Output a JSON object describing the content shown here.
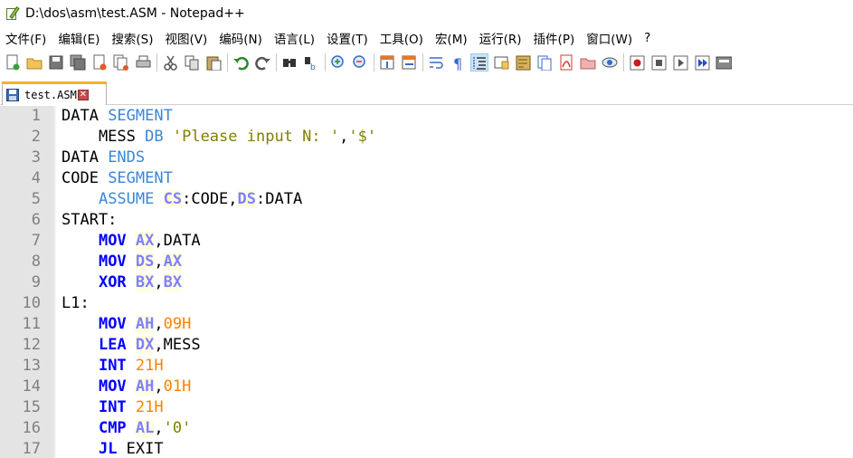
{
  "window": {
    "title": "D:\\dos\\asm\\test.ASM - Notepad++"
  },
  "menu": [
    "文件(F)",
    "编辑(E)",
    "搜索(S)",
    "视图(V)",
    "编码(N)",
    "语言(L)",
    "设置(T)",
    "工具(O)",
    "宏(M)",
    "运行(R)",
    "插件(P)",
    "窗口(W)",
    "?"
  ],
  "toolbar": [
    {
      "name": "new-file-icon"
    },
    {
      "name": "open-file-icon"
    },
    {
      "name": "save-icon"
    },
    {
      "name": "save-all-icon"
    },
    {
      "name": "close-icon"
    },
    {
      "name": "close-all-icon"
    },
    {
      "name": "print-icon"
    },
    {
      "sep": true
    },
    {
      "name": "cut-icon"
    },
    {
      "name": "copy-icon"
    },
    {
      "name": "paste-icon"
    },
    {
      "sep": true
    },
    {
      "name": "undo-icon"
    },
    {
      "name": "redo-icon"
    },
    {
      "sep": true
    },
    {
      "name": "find-icon"
    },
    {
      "name": "replace-icon"
    },
    {
      "sep": true
    },
    {
      "name": "zoom-in-icon"
    },
    {
      "name": "zoom-out-icon"
    },
    {
      "sep": true
    },
    {
      "name": "sync-vertical-icon"
    },
    {
      "name": "sync-horizontal-icon"
    },
    {
      "sep": true
    },
    {
      "name": "word-wrap-icon"
    },
    {
      "name": "show-all-chars-icon"
    },
    {
      "name": "indent-guide-icon",
      "active": true
    },
    {
      "name": "udl-icon"
    },
    {
      "name": "document-map-icon"
    },
    {
      "name": "function-list-icon"
    },
    {
      "name": "pdf-icon"
    },
    {
      "name": "folder-workspace-icon"
    },
    {
      "name": "monitor-icon"
    },
    {
      "sep": true
    },
    {
      "name": "record-macro-icon"
    },
    {
      "name": "stop-macro-icon"
    },
    {
      "name": "play-macro-icon"
    },
    {
      "name": "run-macro-multiple-icon"
    },
    {
      "name": "save-macro-icon"
    }
  ],
  "tab": {
    "label": "test.ASM"
  },
  "colors": {
    "directive": "#3a86d8",
    "instruction": "#0000ff",
    "register": "#8080ff",
    "string": "#808000",
    "number": "#ff8000",
    "gutter": "#e4e4e4",
    "tab_accent": "#fab028"
  },
  "lines": [
    {
      "no": "1",
      "tokens": [
        {
          "t": "DATA ",
          "c": "id"
        },
        {
          "t": "SEGMENT",
          "c": "dir"
        }
      ]
    },
    {
      "no": "2",
      "tokens": [
        {
          "t": "    MESS ",
          "c": "id"
        },
        {
          "t": "DB",
          "c": "dir"
        },
        {
          "t": " ",
          "c": "id"
        },
        {
          "t": "'Please input N: '",
          "c": "str"
        },
        {
          "t": ",",
          "c": "op"
        },
        {
          "t": "'$'",
          "c": "str"
        }
      ]
    },
    {
      "no": "3",
      "tokens": [
        {
          "t": "DATA ",
          "c": "id"
        },
        {
          "t": "ENDS",
          "c": "dir"
        }
      ]
    },
    {
      "no": "4",
      "tokens": [
        {
          "t": "CODE ",
          "c": "id"
        },
        {
          "t": "SEGMENT",
          "c": "dir"
        }
      ]
    },
    {
      "no": "5",
      "tokens": [
        {
          "t": "    ",
          "c": "id"
        },
        {
          "t": "ASSUME",
          "c": "dir"
        },
        {
          "t": " ",
          "c": "id"
        },
        {
          "t": "CS",
          "c": "reg"
        },
        {
          "t": ":CODE,",
          "c": "op"
        },
        {
          "t": "DS",
          "c": "reg"
        },
        {
          "t": ":DATA",
          "c": "op"
        }
      ]
    },
    {
      "no": "6",
      "tokens": [
        {
          "t": "START:",
          "c": "id"
        }
      ]
    },
    {
      "no": "7",
      "tokens": [
        {
          "t": "    ",
          "c": "id"
        },
        {
          "t": "MOV",
          "c": "ins"
        },
        {
          "t": " ",
          "c": "id"
        },
        {
          "t": "AX",
          "c": "reg"
        },
        {
          "t": ",DATA",
          "c": "op"
        }
      ]
    },
    {
      "no": "8",
      "tokens": [
        {
          "t": "    ",
          "c": "id"
        },
        {
          "t": "MOV",
          "c": "ins"
        },
        {
          "t": " ",
          "c": "id"
        },
        {
          "t": "DS",
          "c": "reg"
        },
        {
          "t": ",",
          "c": "op"
        },
        {
          "t": "AX",
          "c": "reg"
        }
      ]
    },
    {
      "no": "9",
      "tokens": [
        {
          "t": "    ",
          "c": "id"
        },
        {
          "t": "XOR",
          "c": "ins"
        },
        {
          "t": " ",
          "c": "id"
        },
        {
          "t": "BX",
          "c": "reg"
        },
        {
          "t": ",",
          "c": "op"
        },
        {
          "t": "BX",
          "c": "reg"
        }
      ]
    },
    {
      "no": "10",
      "tokens": [
        {
          "t": "L1:",
          "c": "id"
        }
      ]
    },
    {
      "no": "11",
      "tokens": [
        {
          "t": "    ",
          "c": "id"
        },
        {
          "t": "MOV",
          "c": "ins"
        },
        {
          "t": " ",
          "c": "id"
        },
        {
          "t": "AH",
          "c": "reg"
        },
        {
          "t": ",",
          "c": "op"
        },
        {
          "t": "09H",
          "c": "num"
        }
      ]
    },
    {
      "no": "12",
      "tokens": [
        {
          "t": "    ",
          "c": "id"
        },
        {
          "t": "LEA",
          "c": "ins"
        },
        {
          "t": " ",
          "c": "id"
        },
        {
          "t": "DX",
          "c": "reg"
        },
        {
          "t": ",MESS",
          "c": "op"
        }
      ]
    },
    {
      "no": "13",
      "tokens": [
        {
          "t": "    ",
          "c": "id"
        },
        {
          "t": "INT",
          "c": "ins"
        },
        {
          "t": " ",
          "c": "id"
        },
        {
          "t": "21H",
          "c": "num"
        }
      ]
    },
    {
      "no": "14",
      "tokens": [
        {
          "t": "    ",
          "c": "id"
        },
        {
          "t": "MOV",
          "c": "ins"
        },
        {
          "t": " ",
          "c": "id"
        },
        {
          "t": "AH",
          "c": "reg"
        },
        {
          "t": ",",
          "c": "op"
        },
        {
          "t": "01H",
          "c": "num"
        }
      ]
    },
    {
      "no": "15",
      "tokens": [
        {
          "t": "    ",
          "c": "id"
        },
        {
          "t": "INT",
          "c": "ins"
        },
        {
          "t": " ",
          "c": "id"
        },
        {
          "t": "21H",
          "c": "num"
        }
      ]
    },
    {
      "no": "16",
      "tokens": [
        {
          "t": "    ",
          "c": "id"
        },
        {
          "t": "CMP",
          "c": "ins"
        },
        {
          "t": " ",
          "c": "id"
        },
        {
          "t": "AL",
          "c": "reg"
        },
        {
          "t": ",",
          "c": "op"
        },
        {
          "t": "'0'",
          "c": "str"
        }
      ]
    },
    {
      "no": "17",
      "tokens": [
        {
          "t": "    ",
          "c": "id"
        },
        {
          "t": "JL",
          "c": "ins"
        },
        {
          "t": " EXIT",
          "c": "id"
        }
      ]
    }
  ]
}
